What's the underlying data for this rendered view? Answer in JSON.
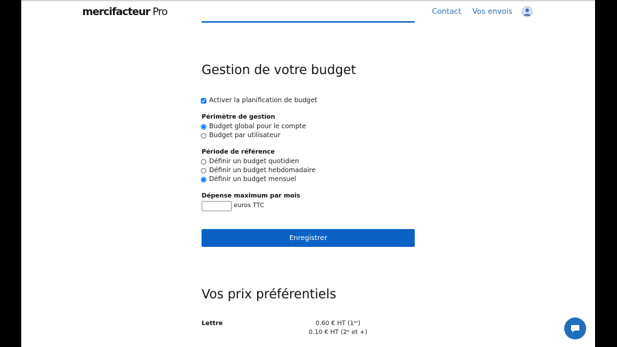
{
  "header": {
    "logo_main": "mercifacteur",
    "logo_suffix": " Pro",
    "nav": {
      "contact": "Contact",
      "envois": "Vos envois"
    }
  },
  "budget": {
    "title": "Gestion de votre budget",
    "enable_label": "Activer la planification de budget",
    "enable_checked": true,
    "perimeter": {
      "title": "Périmètre de gestion",
      "options": [
        {
          "label": "Budget global pour le compte",
          "selected": true
        },
        {
          "label": "Budget par utilisateur",
          "selected": false
        }
      ]
    },
    "period": {
      "title": "Période de référence",
      "options": [
        {
          "label": "Définir un budget quotidien",
          "selected": false
        },
        {
          "label": "Définir un budget hebdomadaire",
          "selected": false
        },
        {
          "label": "Définir un budget mensuel",
          "selected": true
        }
      ]
    },
    "max_spend": {
      "title": "Dépense maximum par mois",
      "value": "",
      "unit": "euros TTC"
    },
    "save_label": "Enregistrer"
  },
  "prices": {
    "title": "Vos prix préférentiels",
    "items": [
      {
        "name": "Lettre",
        "line1": "0.60 € HT (1ᵉʳ)",
        "line2": "0.10 € HT (2ᵉ et +)"
      }
    ]
  },
  "colors": {
    "accent": "#0b62c4",
    "link": "#2b6cb0",
    "chat": "#1f6fbd"
  },
  "icons": {
    "avatar": "user-avatar-icon",
    "chat": "chat-bubble-icon"
  }
}
